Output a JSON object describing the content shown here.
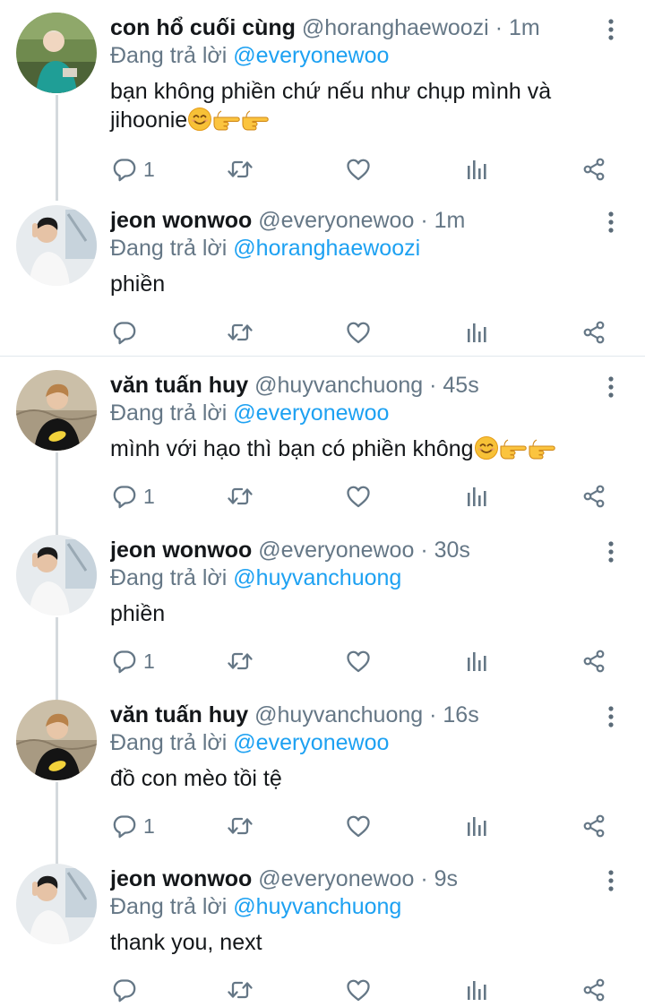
{
  "colors": {
    "accent": "#1da1f2",
    "muted": "#657786",
    "text": "#14171a"
  },
  "tweets": [
    {
      "name": "con hổ cuối cùng",
      "handle": "@horanghaewoozi",
      "sep": "·",
      "time": "1m",
      "reply_prefix": "Đang trả lời",
      "reply_to": "@everyonewoo",
      "text_lines": [
        "bạn không phiền chứ nếu như chụp mình và",
        "jihoonie"
      ],
      "emojis": [
        "smiling-face-icon",
        "pointing-hand-icon",
        "pointing-hand-icon"
      ],
      "reply_count": "1",
      "avatar_icon": "avatar-photo"
    },
    {
      "name": "jeon wonwoo",
      "handle": "@everyonewoo",
      "sep": "·",
      "time": "1m",
      "reply_prefix": "Đang trả lời",
      "reply_to": "@horanghaewoozi",
      "text_lines": [
        "phiền"
      ],
      "emojis": [],
      "reply_count": "",
      "avatar_icon": "avatar-photo"
    },
    {
      "name": "văn tuấn huy",
      "handle": "@huyvanchuong",
      "sep": "·",
      "time": "45s",
      "reply_prefix": "Đang trả lời",
      "reply_to": "@everyonewoo",
      "text_lines": [
        "mình với hạo thì bạn có phiền không"
      ],
      "emojis": [
        "smiling-face-icon",
        "pointing-hand-icon",
        "pointing-hand-icon"
      ],
      "reply_count": "1",
      "avatar_icon": "avatar-photo"
    },
    {
      "name": "jeon wonwoo",
      "handle": "@everyonewoo",
      "sep": "·",
      "time": "30s",
      "reply_prefix": "Đang trả lời",
      "reply_to": "@huyvanchuong",
      "text_lines": [
        "phiền"
      ],
      "emojis": [],
      "reply_count": "1",
      "avatar_icon": "avatar-photo"
    },
    {
      "name": "văn tuấn huy",
      "handle": "@huyvanchuong",
      "sep": "·",
      "time": "16s",
      "reply_prefix": "Đang trả lời",
      "reply_to": "@everyonewoo",
      "text_lines": [
        "đồ con mèo tồi tệ"
      ],
      "emojis": [],
      "reply_count": "1",
      "avatar_icon": "avatar-photo"
    },
    {
      "name": "jeon wonwoo",
      "handle": "@everyonewoo",
      "sep": "·",
      "time": "9s",
      "reply_prefix": "Đang trả lời",
      "reply_to": "@huyvanchuong",
      "text_lines": [
        "thank you, next"
      ],
      "emojis": [],
      "reply_count": "",
      "avatar_icon": "avatar-photo"
    }
  ]
}
